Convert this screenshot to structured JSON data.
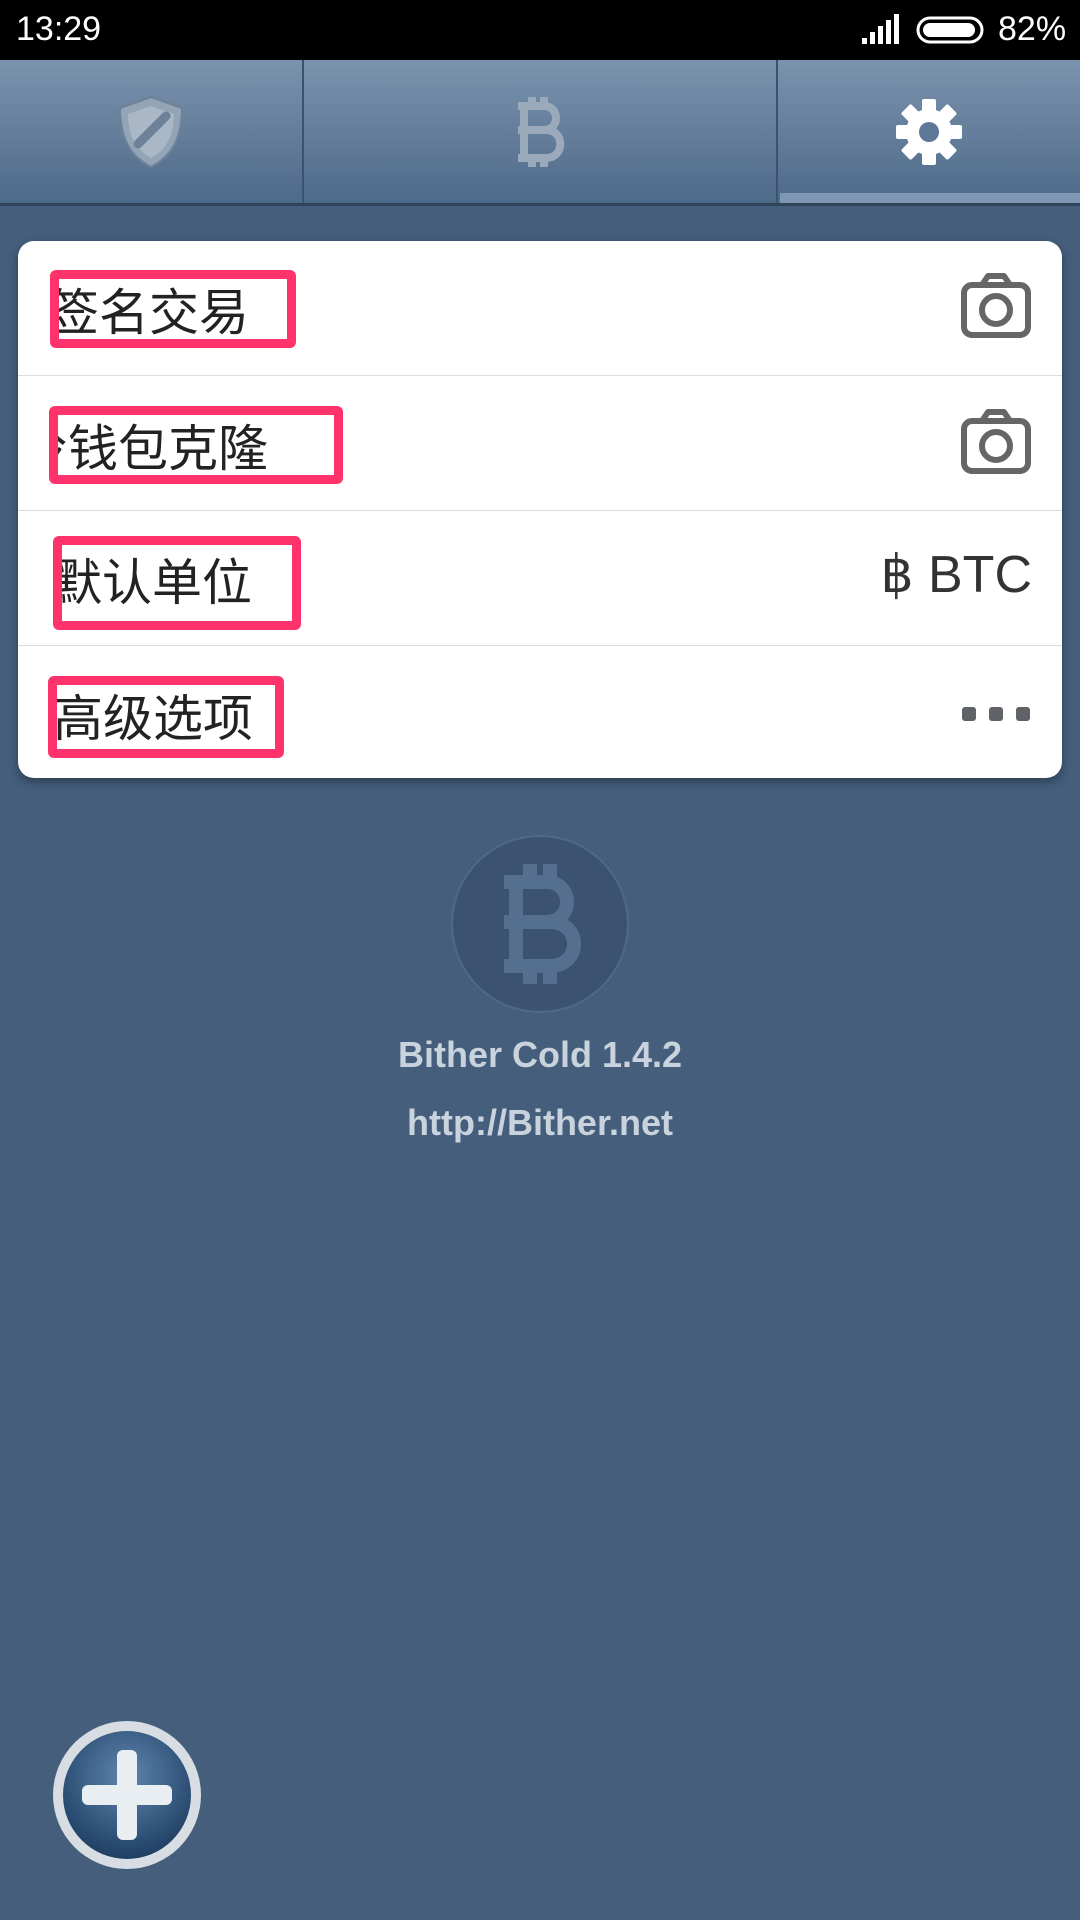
{
  "status_bar": {
    "time": "13:29",
    "battery": "82%"
  },
  "tabs": [
    {
      "icon": "shield-icon"
    },
    {
      "icon": "bitcoin-icon"
    },
    {
      "icon": "gear-icon",
      "selected": true
    }
  ],
  "settings": [
    {
      "label": "签名交易",
      "action_icon": "camera-icon"
    },
    {
      "label": "冷钱包克隆",
      "action_icon": "camera-icon"
    },
    {
      "label": "默认单位",
      "value": "฿ BTC"
    },
    {
      "label": "高级选项",
      "action_icon": "more-icon"
    }
  ],
  "about": {
    "name": "Bither Cold  1.4.2",
    "url": "http://Bither.net"
  },
  "colors": {
    "background": "#445e7c",
    "highlight": "#ff336b",
    "card": "#ffffff"
  },
  "fab": {
    "icon": "plus-icon"
  }
}
